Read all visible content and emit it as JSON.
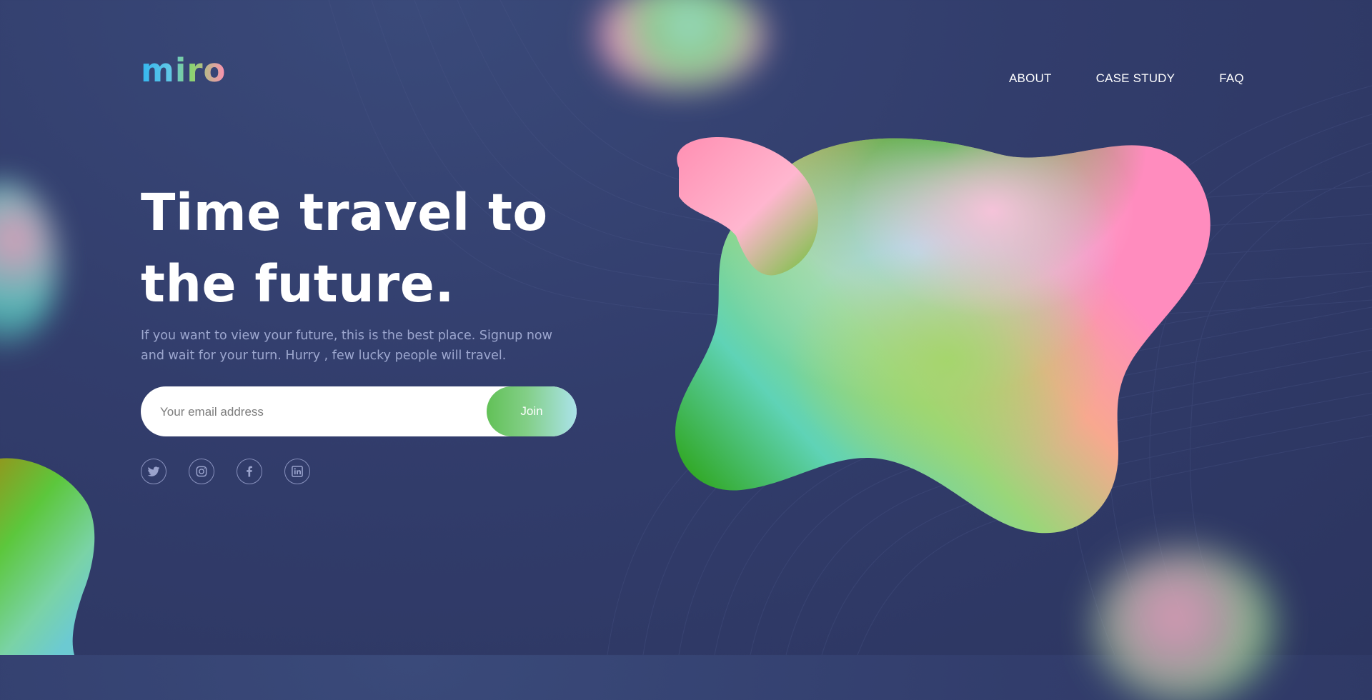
{
  "brand": {
    "logo_text": "miro"
  },
  "nav": {
    "items": [
      {
        "label": "ABOUT"
      },
      {
        "label": "CASE STUDY"
      },
      {
        "label": "FAQ"
      }
    ]
  },
  "hero": {
    "title_line1": "Time travel to",
    "title_line2": "the future.",
    "subtitle_line1": "If you want to view your future, this is the best place. Signup now",
    "subtitle_line2": "and wait for your turn. Hurry , few lucky people will travel."
  },
  "signup": {
    "email_placeholder": "Your email address",
    "email_value": "",
    "join_label": "Join"
  },
  "socials": [
    {
      "icon": "twitter-icon"
    },
    {
      "icon": "instagram-icon"
    },
    {
      "icon": "facebook-icon"
    },
    {
      "icon": "linkedin-icon"
    }
  ],
  "colors": {
    "background": "#323d6c",
    "text_primary": "#ffffff",
    "text_secondary": "#9da7cf",
    "accent_green": "#62c157",
    "accent_pink": "#ff8fb2",
    "accent_cyan": "#abe3ea"
  }
}
